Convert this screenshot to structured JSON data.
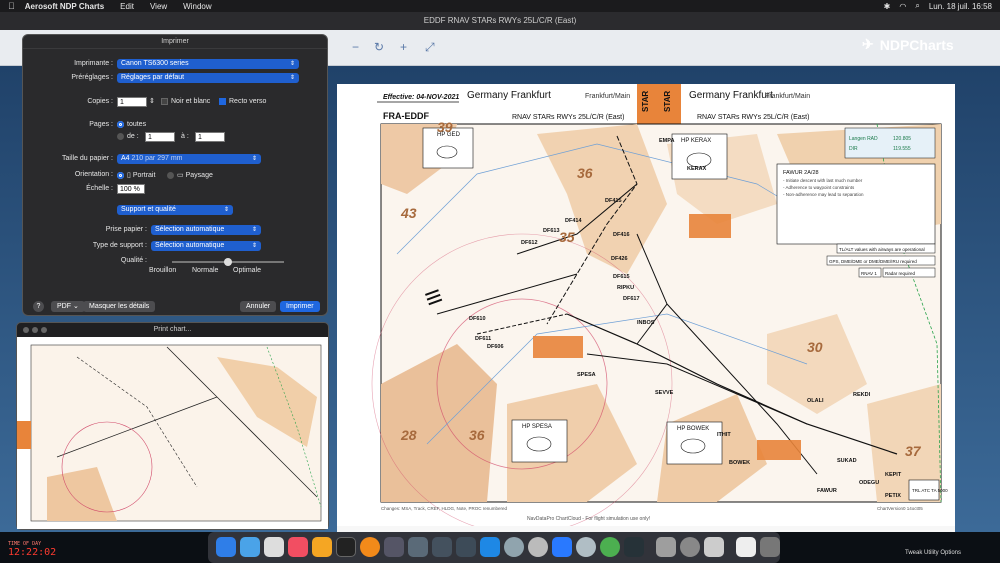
{
  "menubar": {
    "apple": "",
    "app": "Aerosoft NDP Charts",
    "items": [
      "Edit",
      "View",
      "Window"
    ],
    "clock": "Lun. 18 juil.  16:58"
  },
  "window": {
    "title": "EDDF RNAV STARs RWYs 25L/C/R (East)"
  },
  "brand": {
    "name": "NDPCharts"
  },
  "print_dialog": {
    "title": "Imprimer",
    "imprimante_label": "Imprimante :",
    "imprimante_value": "Canon TS6300 series",
    "prereglages_label": "Préréglages :",
    "prereglages_value": "Réglages par défaut",
    "copies_label": "Copies :",
    "copies_value": "1",
    "noir_blanc": "Noir et blanc",
    "recto_verso": "Recto verso",
    "pages_label": "Pages :",
    "pages_toutes": "toutes",
    "pages_de": "de :",
    "pages_de_value": "1",
    "pages_a": "à :",
    "pages_a_value": "1",
    "taille_label": "Taille du papier :",
    "taille_value": "A4",
    "taille_dims": "210 par 297 mm",
    "orientation_label": "Orientation :",
    "portrait": "Portrait",
    "paysage": "Paysage",
    "echelle_label": "Échelle :",
    "echelle_value": "100 %",
    "support_section": "Support et qualité",
    "prise_label": "Prise papier :",
    "prise_value": "Sélection automatique",
    "type_label": "Type de support :",
    "type_value": "Sélection automatique",
    "qualite_label": "Qualité :",
    "qualite_min": "Brouillon",
    "qualite_mid": "Normale",
    "qualite_max": "Optimale",
    "help": "?",
    "pdf": "PDF",
    "masquer": "Masquer les détails",
    "annuler": "Annuler",
    "imprimer": "Imprimer"
  },
  "preview": {
    "title": "Print chart..."
  },
  "chart": {
    "effective": "Effective: 04-NOV-2021",
    "title_left_city": "Germany Frankfurt",
    "title_left_sub": "Frankfurt/Main",
    "code": "FRA-EDDF",
    "subtitle": "RNAV STARs RWYs 25L/C/R (East)",
    "star": "STAR",
    "title_right_city": "Germany Frankfurt",
    "title_right_sub": "Frankfurt/Main",
    "hp_ged": "HP GED",
    "hp_kerax": "HP KERAX",
    "hp_spesa": "HP SPESA",
    "hp_bowek": "HP BOWEK",
    "fixes": [
      "KERAX",
      "EMPA",
      "RIPKU",
      "INBOS",
      "SPESA",
      "BOWEK",
      "SUKAD",
      "OLALI",
      "REKDI",
      "KEPIT",
      "ODEGU",
      "PETIX",
      "FAWUR",
      "ITHIT",
      "SEVVE",
      "DF610",
      "DF611",
      "DF612",
      "DF613",
      "DF414",
      "DF415",
      "DF416",
      "DF426",
      "DF606",
      "DF617",
      "DF615"
    ],
    "numbers": [
      "39",
      "36",
      "43",
      "35",
      "28",
      "30",
      "37",
      "36"
    ],
    "notes": [
      "FAWUR 2A/28",
      "TL/ALT values with airways are operational",
      "GPS, DME/DME or DME/DME/IRU required",
      "RNAV 1",
      "Radar required"
    ],
    "freq": [
      {
        "name": "Langen RAD",
        "v": "120.805"
      },
      {
        "name": "DIR",
        "v": "119.555"
      }
    ],
    "changes": "Changes: MSA, Track, CREF, HLDG, Note, PROC renumbered",
    "source": "NavDataPro ChartCloud - For flight simulation use only!",
    "chartversion": "ChartVersion0 14oct05",
    "trans": "TRL ATC TA 5000"
  },
  "clock": {
    "label": "TIME OF DAY",
    "value": "12:22:02"
  },
  "tweak": "Tweak Utility Options"
}
